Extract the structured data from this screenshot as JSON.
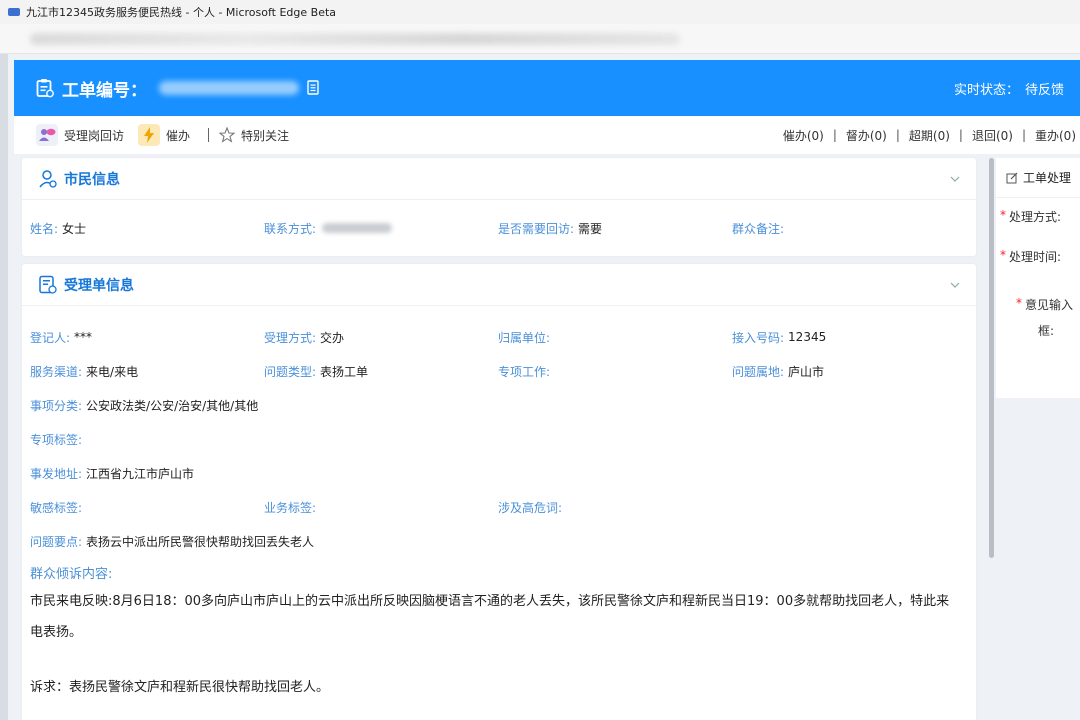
{
  "window": {
    "title": "九江市12345政务服务便民热线 - 个人 - Microsoft Edge Beta"
  },
  "header": {
    "order_label": "工单编号：",
    "status_label": "实时状态：",
    "status_value": "待反馈"
  },
  "toolbar": {
    "actions": [
      {
        "label": "受理岗回访",
        "icon": "chat-icon"
      },
      {
        "label": "催办",
        "icon": "lightning-icon"
      },
      {
        "label": "特别关注",
        "icon": "star-icon"
      }
    ],
    "counters": [
      "催办(0)",
      "督办(0)",
      "超期(0)",
      "退回(0)",
      "重办(0)"
    ]
  },
  "citizen": {
    "title": "市民信息",
    "name_label": "姓名:",
    "name_value": "女士",
    "contact_label": "联系方式:",
    "callback_label": "是否需要回访:",
    "callback_value": "需要",
    "remark_label": "群众备注:"
  },
  "ticket": {
    "title": "受理单信息",
    "rows": [
      [
        {
          "label": "登记人:",
          "value": "***"
        },
        {
          "label": "受理方式:",
          "value": "交办"
        },
        {
          "label": "归属单位:",
          "value": ""
        },
        {
          "label": "接入号码:",
          "value": "12345"
        }
      ],
      [
        {
          "label": "服务渠道:",
          "value": "来电/来电"
        },
        {
          "label": "问题类型:",
          "value": "表扬工单"
        },
        {
          "label": "专项工作:",
          "value": ""
        },
        {
          "label": "问题属地:",
          "value": "庐山市"
        }
      ]
    ],
    "category_label": "事项分类:",
    "category_value": "公安政法类/公安/治安/其他/其他",
    "special_tag_label": "专项标签:",
    "address_label": "事发地址:",
    "address_value": "江西省九江市庐山市",
    "sensitive_label": "敏感标签:",
    "business_label": "业务标签:",
    "risk_label": "涉及高危词:",
    "key_point_label": "问题要点:",
    "key_point_value": "表扬云中派出所民警很快帮助找回丢失老人",
    "complaint_label": "群众倾诉内容:",
    "complaint_text": "市民来电反映:8月6日18：00多向庐山市庐山上的云中派出所反映因脑梗语言不通的老人丢失，该所民警徐文庐和程新民当日19：00多就帮助找回老人，特此来电表扬。",
    "appeal_text": "诉求：表扬民警徐文庐和程新民很快帮助找回老人。"
  },
  "processing": {
    "title": "工单处理",
    "method_label": "处理方式:",
    "time_label": "处理时间:",
    "opinion_label_1": "意见输入",
    "opinion_label_2": "框:"
  },
  "colors": {
    "header_blue": "#1890ff",
    "label_blue": "#4a90d9",
    "title_blue": "#1677d9",
    "required_red": "#f5222d"
  }
}
